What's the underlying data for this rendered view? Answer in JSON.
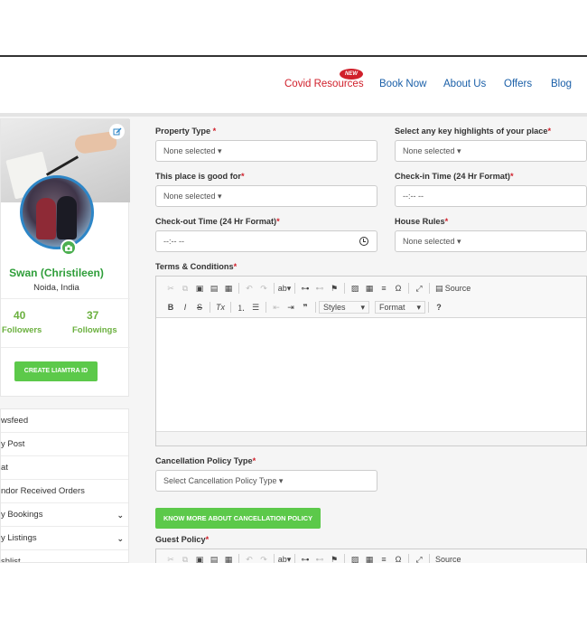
{
  "nav": {
    "items": [
      "Covid Resources",
      "Book Now",
      "About Us",
      "Offers",
      "Blog"
    ],
    "new_badge": "NEW"
  },
  "profile": {
    "name": "Swan (Christileen)",
    "location": "Noida, India",
    "followers_count": "40",
    "followers_label": "Followers",
    "followings_count": "37",
    "followings_label": "Followings",
    "create_button": "CREATE LIAMTRA ID"
  },
  "sidebar": {
    "items": [
      {
        "label": "wsfeed",
        "has_chevron": false
      },
      {
        "label": "y Post",
        "has_chevron": false
      },
      {
        "label": "at",
        "has_chevron": false
      },
      {
        "label": "ndor Received Orders",
        "has_chevron": false
      },
      {
        "label": "y Bookings",
        "has_chevron": true
      },
      {
        "label": "y Listings",
        "has_chevron": true
      },
      {
        "label": "shlist",
        "has_chevron": true
      }
    ]
  },
  "form": {
    "property_type": {
      "label": "Property Type ",
      "value": "None selected ▾"
    },
    "highlights": {
      "label": "Select any key highlights of your place",
      "value": "None selected ▾"
    },
    "good_for": {
      "label": "This place is good for",
      "value": "None selected ▾"
    },
    "checkin": {
      "label": "Check-in Time (24 Hr Format)",
      "value": "--:-- --"
    },
    "checkout": {
      "label": "Check-out Time (24 Hr Format)",
      "value": "--:-- --"
    },
    "house_rules": {
      "label": "House Rules",
      "value": "None selected ▾"
    },
    "terms": {
      "label": "Terms & Conditions"
    },
    "cancellation": {
      "label": "Cancellation Policy Type",
      "value": "Select Cancellation Policy Type ▾"
    },
    "cancel_button": "KNOW MORE ABOUT CANCELLATION POLICY",
    "guest_policy": {
      "label": "Guest Policy"
    },
    "required_mark": "*"
  },
  "editor": {
    "source_label": "Source",
    "styles_label": "Styles",
    "format_label": "Format"
  }
}
